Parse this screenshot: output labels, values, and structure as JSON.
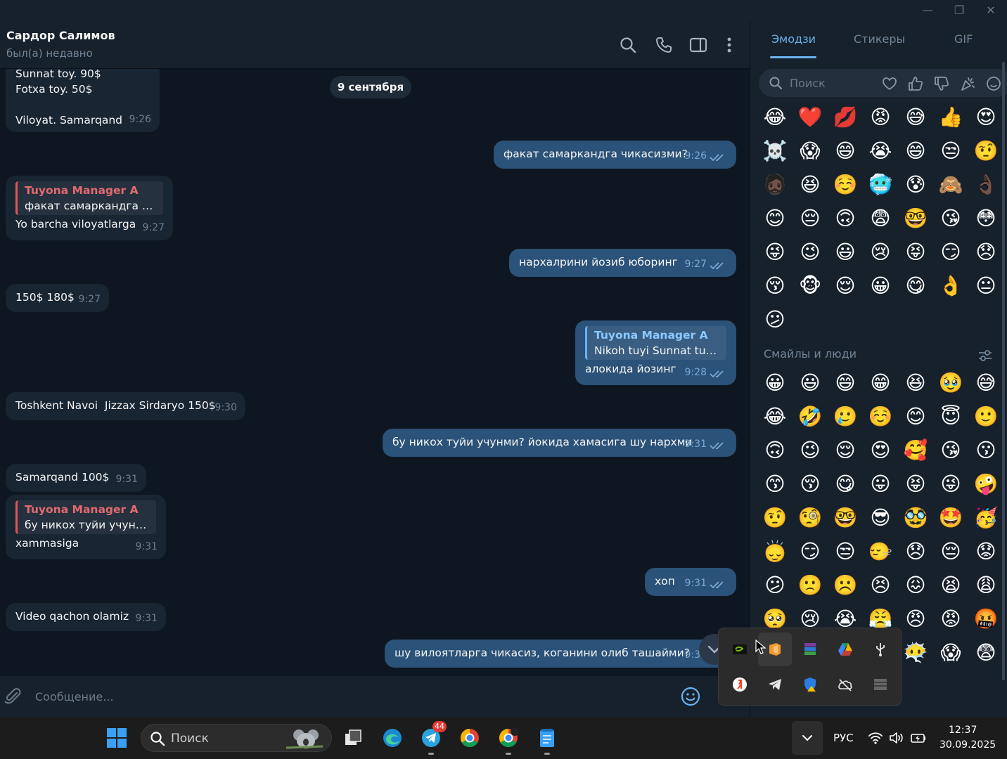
{
  "window": {
    "minimize": "—",
    "restore": "❐",
    "close": "✕"
  },
  "chat": {
    "peer_name": "Сардор Салимов",
    "peer_status": "был(а) недавно",
    "date_separator": "9 сентября",
    "messages": [
      {
        "text": "Sunnat toy. 90$\nFotxa toy. 50$\n\nViloyat. Samarqand",
        "time": "9:26"
      },
      {
        "text": "факат самаркандга чикасизми?",
        "time": "9:26"
      },
      {
        "reply_name": "Tuyona Manager A",
        "reply_text": "факат самаркандга чи...",
        "text": "Yo barcha viloyatlarga",
        "time": "9:27"
      },
      {
        "text": "нархалрини йозиб юборинг",
        "time": "9:27"
      },
      {
        "text": "150$ 180$",
        "time": "9:27"
      },
      {
        "reply_name": "Tuyona Manager A",
        "reply_text": "Nikoh tuyi Sunnat tuyi...",
        "text": "алокида йозинг",
        "time": "9:28"
      },
      {
        "text": "Toshkent Navoi  Jizzax Sirdaryo 150$",
        "time": "9:30"
      },
      {
        "text": "бу никох туйи учунми? йокида хамасига шу нархми",
        "time": "9:31"
      },
      {
        "text": "Samarqand 100$",
        "time": "9:31"
      },
      {
        "reply_name": "Tuyona Manager A",
        "reply_text": "бу никох туйи учунм...",
        "text": "xammasiga",
        "time": "9:31"
      },
      {
        "text": "хоп",
        "time": "9:31"
      },
      {
        "text": "Video qachon olamiz",
        "time": "9:31"
      },
      {
        "text": "шу вилоятларга чикасиз, коганини олиб ташайми?",
        "time": "9:31"
      }
    ],
    "composer_placeholder": "Сообщение..."
  },
  "emoji_panel": {
    "tabs": [
      "Эмодзи",
      "Стикеры",
      "GIF"
    ],
    "search_placeholder": "Поиск",
    "section_title": "Смайлы и люди",
    "recent": [
      "😂",
      "❤️",
      "💋",
      "😡",
      "😅",
      "👍",
      "😍",
      "☠️",
      "😱",
      "😄",
      "😭",
      "😄",
      "😒",
      "🤨",
      "🧔🏿",
      "😆",
      "☺️",
      "🥶",
      "😰",
      "🙈",
      "👌🏿",
      "😊",
      "😔",
      "🙃",
      "😨",
      "🤓",
      "😘",
      "😳",
      "😜",
      "😉",
      "😃",
      "😢",
      "😝",
      "😏",
      "😞",
      "😚",
      "🐵",
      "😌",
      "😀",
      "😋",
      "👌",
      "😐",
      "😕"
    ],
    "smileys": [
      "😀",
      "😃",
      "😄",
      "😁",
      "😆",
      "🥹",
      "😅",
      "😂",
      "🤣",
      "🥲",
      "☺️",
      "😊",
      "😇",
      "🙂",
      "🙃",
      "😉",
      "😌",
      "😍",
      "🥰",
      "😘",
      "😗",
      "😙",
      "😚",
      "😋",
      "😛",
      "😝",
      "😜",
      "🤪",
      "🤨",
      "🧐",
      "🤓",
      "😎",
      "🥸",
      "🤩",
      "🥳",
      "🙂‍↕️",
      "😏",
      "😒",
      "🙂‍↔️",
      "😞",
      "😔",
      "😟",
      "😕",
      "🙁",
      "☹️",
      "😣",
      "😖",
      "😫",
      "😩",
      "🥺",
      "😢",
      "😭",
      "😤",
      "😠",
      "😡",
      "🤬",
      "🤯",
      "😳",
      "🥵",
      "🥶",
      "😶‍🌫️",
      "😱",
      "😨"
    ]
  },
  "taskbar": {
    "search_placeholder": "Поиск",
    "telegram_badge": "44",
    "language": "РУС",
    "time": "12:37",
    "date": "30.09.2025"
  }
}
